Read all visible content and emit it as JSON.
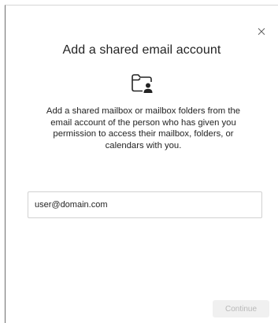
{
  "dialog": {
    "title": "Add a shared email account",
    "description": "Add a shared mailbox or mailbox folders from the email account of the person who has given you permission to access their mailbox, folders, or calendars with you.",
    "icon": "shared-folder-person-icon",
    "close_icon": "close-icon"
  },
  "email_field": {
    "value": "user@domain.com",
    "placeholder": ""
  },
  "continue_button": {
    "label": "Continue",
    "state": "disabled"
  },
  "colors": {
    "text": "#242424",
    "border": "#d1d1d1",
    "disabled_bg": "#f0f0f0",
    "disabled_text": "#b8b8b8"
  }
}
